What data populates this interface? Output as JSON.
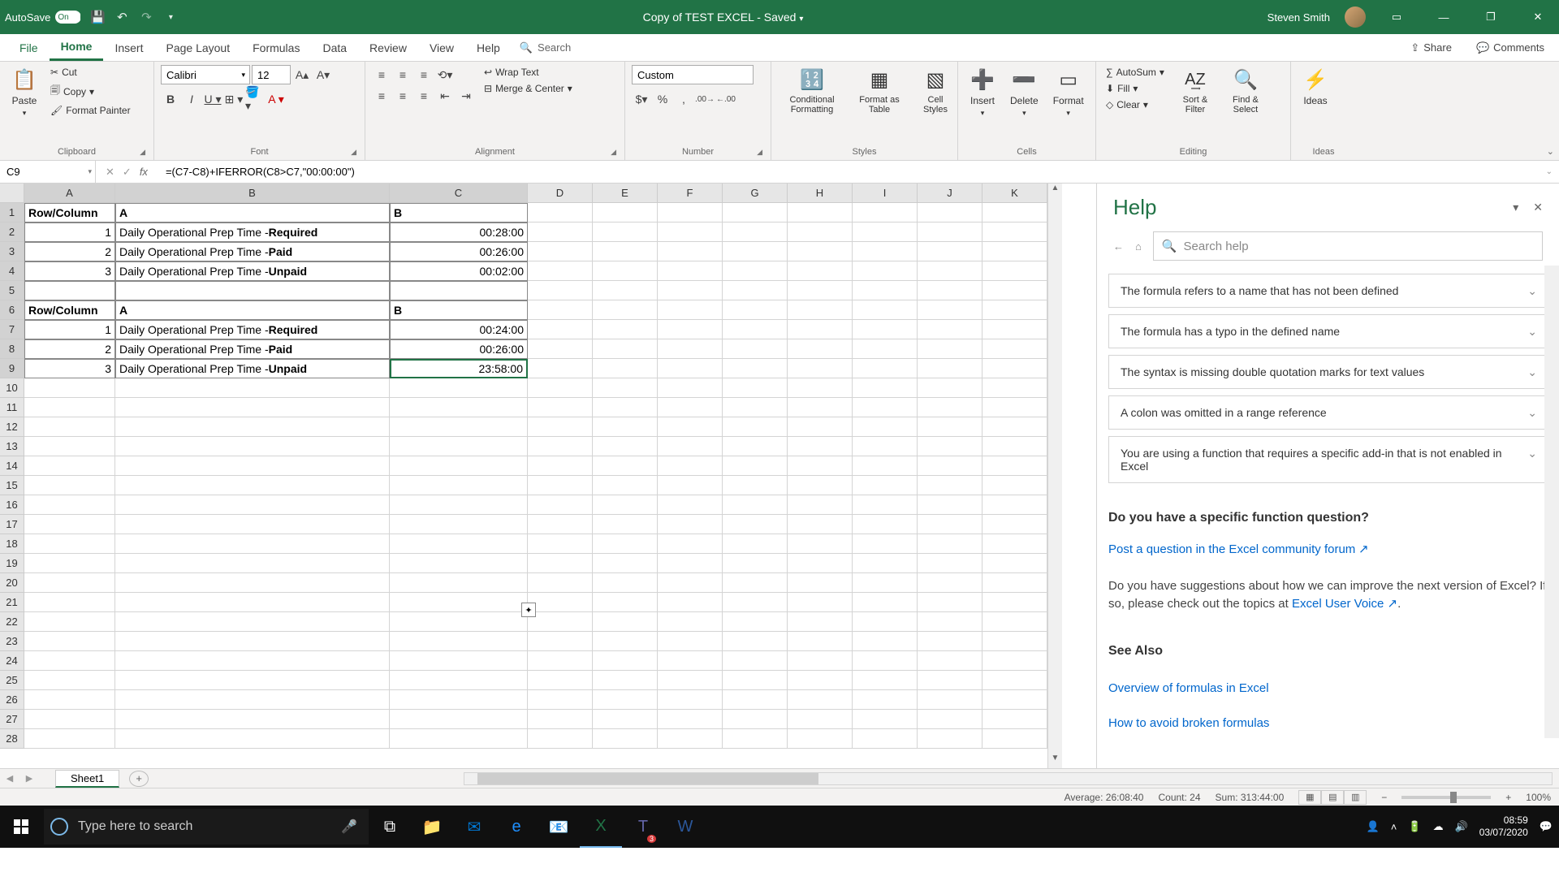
{
  "titlebar": {
    "autosave": "AutoSave",
    "autosave_state": "On",
    "doc": "Copy of TEST EXCEL  -  Saved",
    "user": "Steven Smith"
  },
  "tabs": {
    "file": "File",
    "home": "Home",
    "insert": "Insert",
    "pagelayout": "Page Layout",
    "formulas": "Formulas",
    "data": "Data",
    "review": "Review",
    "view": "View",
    "help": "Help",
    "tellme": "Search",
    "share": "Share",
    "comments": "Comments"
  },
  "ribbon": {
    "clipboard": {
      "paste": "Paste",
      "cut": "Cut",
      "copy": "Copy",
      "fmtpainter": "Format Painter",
      "label": "Clipboard"
    },
    "font": {
      "name": "Calibri",
      "size": "12",
      "label": "Font"
    },
    "alignment": {
      "wrap": "Wrap Text",
      "merge": "Merge & Center",
      "label": "Alignment"
    },
    "number": {
      "fmt": "Custom",
      "label": "Number"
    },
    "styles": {
      "cond": "Conditional Formatting",
      "fas": "Format as Table",
      "cell": "Cell Styles",
      "label": "Styles"
    },
    "cells": {
      "insert": "Insert",
      "delete": "Delete",
      "format": "Format",
      "label": "Cells"
    },
    "editing": {
      "autosum": "AutoSum",
      "fill": "Fill",
      "clear": "Clear",
      "sort": "Sort & Filter",
      "find": "Find & Select",
      "label": "Editing"
    },
    "ideas": {
      "ideas": "Ideas",
      "label": "Ideas"
    }
  },
  "formulabar": {
    "namebox": "C9",
    "formula": "=(C7-C8)+IFERROR(C8>C7,\"00:00:00\")"
  },
  "sheet": {
    "cols": [
      "A",
      "B",
      "C",
      "D",
      "E",
      "F",
      "G",
      "H",
      "I",
      "J",
      "K"
    ],
    "r1": {
      "a": "Row/Column",
      "b": "A",
      "c": "B"
    },
    "r2": {
      "a": "1",
      "b_pre": "Daily Operational Prep Time - ",
      "b_bold": "Required",
      "c": "00:28:00"
    },
    "r3": {
      "a": "2",
      "b_pre": "Daily Operational Prep Time - ",
      "b_bold": "Paid",
      "c": "00:26:00"
    },
    "r4": {
      "a": "3",
      "b_pre": "Daily Operational Prep Time - ",
      "b_bold": "Unpaid",
      "c": "00:02:00"
    },
    "r6": {
      "a": "Row/Column",
      "b": "A",
      "c": "B"
    },
    "r7": {
      "a": "1",
      "b_pre": "Daily Operational Prep Time - ",
      "b_bold": "Required",
      "c": "00:24:00"
    },
    "r8": {
      "a": "2",
      "b_pre": "Daily Operational Prep Time - ",
      "b_bold": "Paid",
      "c": "00:26:00"
    },
    "r9": {
      "a": "3",
      "b_pre": "Daily Operational Prep Time - ",
      "b_bold": "Unpaid",
      "c": "23:58:00"
    }
  },
  "help": {
    "title": "Help",
    "search_placeholder": "Search help",
    "items": [
      "The formula refers to a name that has not been defined",
      "The formula has a typo in the defined name",
      "The syntax is missing double quotation marks for text values",
      "A colon was omitted in a range reference",
      "You are using a function that requires a specific add-in that is not enabled in Excel"
    ],
    "q": "Do you have a specific function question?",
    "forum_link": "Post a question in the Excel community forum",
    "suggest_pre": "Do you have suggestions about how we can improve the next version of Excel? If so, please check out the topics at ",
    "uservoice": "Excel User Voice",
    "seealso": "See Also",
    "link1": "Overview of formulas in Excel",
    "link2": "How to avoid broken formulas"
  },
  "sheettabs": {
    "sheet1": "Sheet1"
  },
  "status": {
    "avg": "Average: 26:08:40",
    "count": "Count: 24",
    "sum": "Sum: 313:44:00",
    "zoom": "100%"
  },
  "taskbar": {
    "search": "Type here to search",
    "time": "08:59",
    "date": "03/07/2020",
    "notif_count": "3"
  }
}
